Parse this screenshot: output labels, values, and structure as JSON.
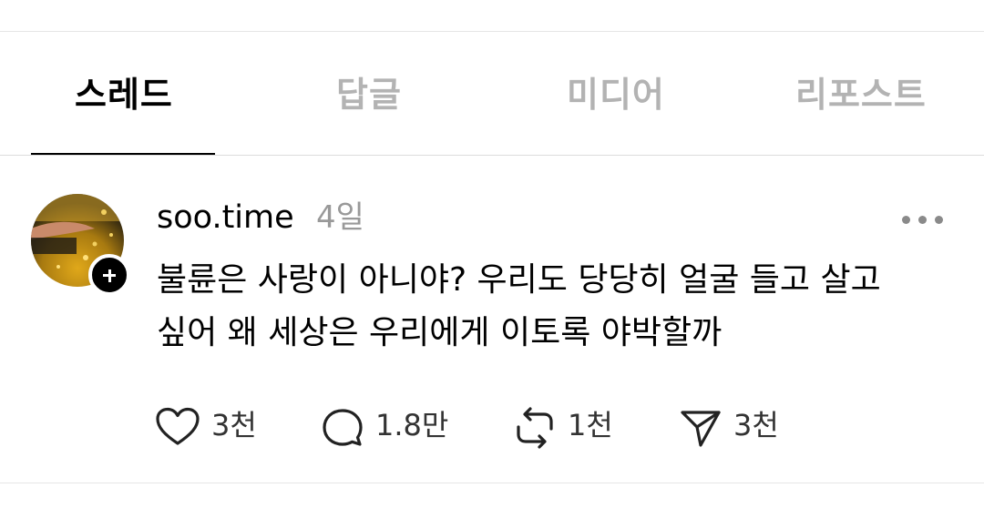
{
  "tabs": [
    {
      "label": "스레드",
      "active": true
    },
    {
      "label": "답글",
      "active": false
    },
    {
      "label": "미디어",
      "active": false
    },
    {
      "label": "리포스트",
      "active": false
    }
  ],
  "post": {
    "username": "soo.time",
    "timestamp": "4일",
    "text": "불륜은 사랑이 아니야? 우리도 당당히 얼굴 들고 살고 싶어 왜 세상은 우리에게 이토록 야박할까",
    "actions": {
      "like": {
        "icon": "heart-icon",
        "count": "3천"
      },
      "reply": {
        "icon": "comment-icon",
        "count": "1.8만"
      },
      "repost": {
        "icon": "repost-icon",
        "count": "1천"
      },
      "share": {
        "icon": "send-icon",
        "count": "3천"
      }
    }
  },
  "colors": {
    "inactive_tab": "#b3b3b3",
    "timestamp": "#999999",
    "accent": "#000000"
  }
}
